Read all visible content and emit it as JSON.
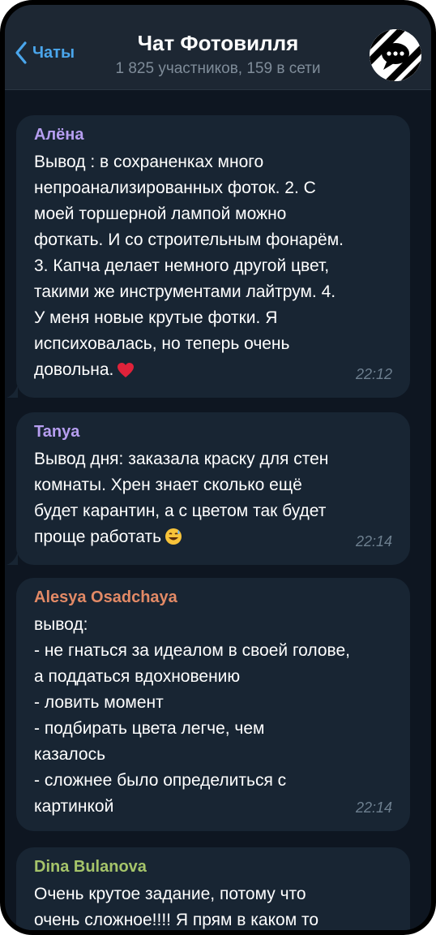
{
  "header": {
    "back_label": "Чаты",
    "title": "Чат Фотовилля",
    "subtitle": "1 825 участников, 159 в сети",
    "back_icon": "chevron-left-icon",
    "avatar_icon": "speech-bubble-icon"
  },
  "colors": {
    "background": "#0e1621",
    "header": "#1d2733",
    "bubble": "#182533",
    "accent": "#4aa6ec",
    "name_alena": "#b69ef0",
    "name_tanya": "#b69ef0",
    "name_alesya": "#e38a66",
    "name_dina": "#a5c46a"
  },
  "messages": [
    {
      "author": "Алёна",
      "text": "Вывод : в сохраненках много\nнепроанализированных фоток. 2. С\nмоей торшерной лампой можно\nфоткать. И со строительным фонарём.\n3. Капча делает немного другой цвет,\nтакими же инструментами лайтрум. 4.\nУ меня новые крутые фотки. Я\nиспсиховалась, но теперь очень\nдовольна.",
      "emoji": "red-heart",
      "time": "22:12"
    },
    {
      "author": "Tanya",
      "text": "Вывод дня: заказала краску для стен\nкомнаты. Хрен знает сколько ещё\nбудет карантин, а с цветом так будет\nпроще работать",
      "emoji": "grinning-sweat-face",
      "time": "22:14"
    },
    {
      "author": "Alesya Osadchaya",
      "text": "вывод:\n- не гнаться за идеалом в своей голове,\nа поддаться вдохновению\n- ловить момент\n- подбирать цвета легче, чем\nказалось\n- сложнее было определиться с\nкартинкой",
      "time": "22:14"
    },
    {
      "author": "Dina Bulanova",
      "text": "Очень крутое задание, потому что\nочень сложное!!!! Я прям в каком то"
    }
  ]
}
